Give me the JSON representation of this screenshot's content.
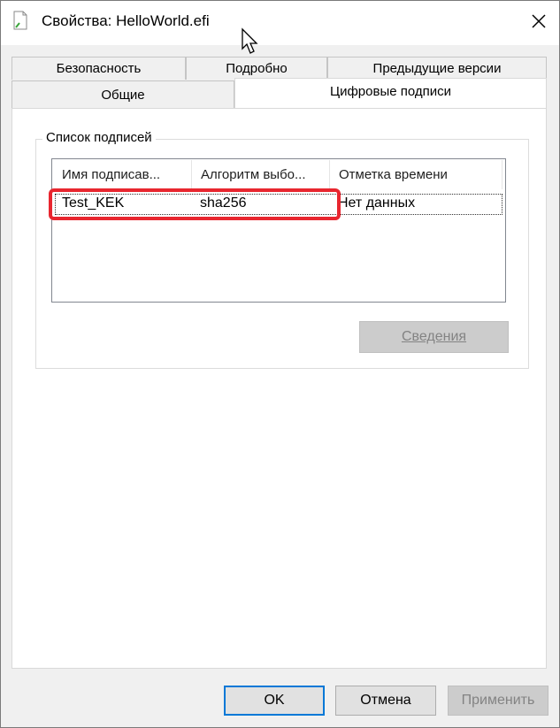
{
  "window": {
    "title": "Свойства: HelloWorld.efi"
  },
  "tabs_back": [
    {
      "label": "Безопасность"
    },
    {
      "label": "Подробно"
    },
    {
      "label": "Предыдущие версии"
    }
  ],
  "tabs_front": [
    {
      "label": "Общие"
    },
    {
      "label": "Цифровые подписи"
    }
  ],
  "signatures": {
    "group_label": "Список подписей",
    "columns": [
      "Имя подписав...",
      "Алгоритм выбо...",
      "Отметка времени"
    ],
    "rows": [
      {
        "name": "Test_KEK",
        "algorithm": "sha256",
        "timestamp": "Нет данных"
      }
    ],
    "details_button": "Сведения"
  },
  "footer": {
    "ok": "OK",
    "cancel": "Отмена",
    "apply": "Применить"
  },
  "colors": {
    "highlight": "#e8262f",
    "default_button_border": "#0078d7"
  }
}
